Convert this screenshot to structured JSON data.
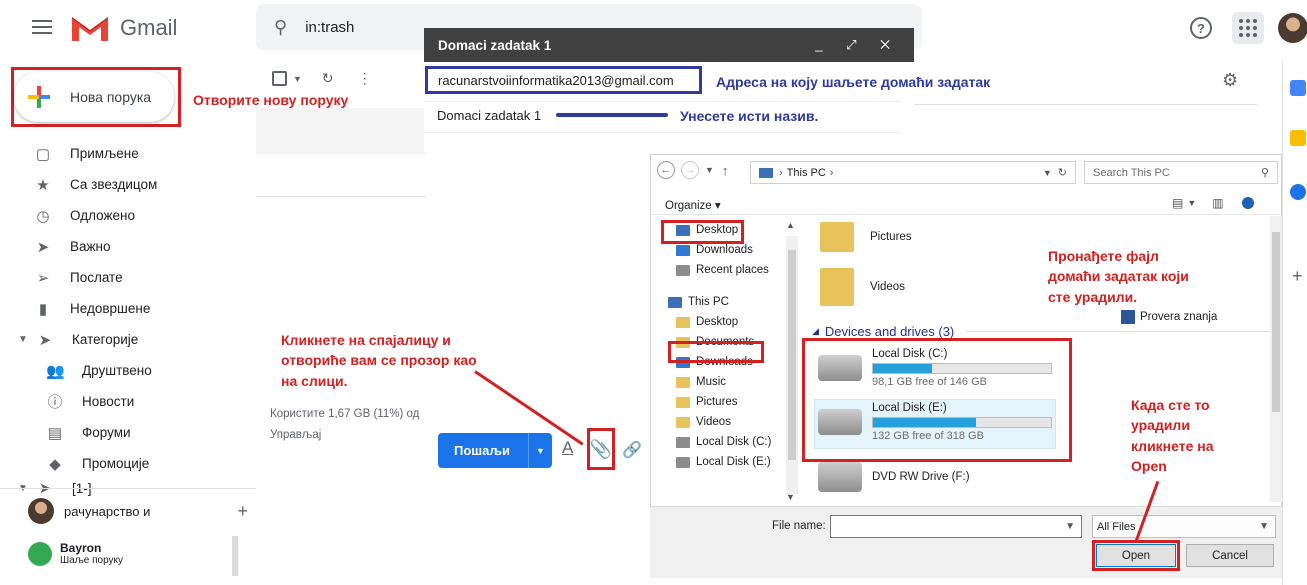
{
  "header": {
    "product": "Gmail",
    "search_query": "in:trash",
    "help_glyph": "?"
  },
  "compose_button": {
    "label": "Нова порука"
  },
  "sidebar": {
    "items": [
      {
        "label": "Примљене",
        "icon": "inbox-icon",
        "glyph": "▢"
      },
      {
        "label": "Са звездицом",
        "icon": "star-icon",
        "glyph": "★"
      },
      {
        "label": "Одложено",
        "icon": "clock-icon",
        "glyph": "◷"
      },
      {
        "label": "Важно",
        "icon": "important-icon",
        "glyph": "➤"
      },
      {
        "label": "Послате",
        "icon": "send-icon",
        "glyph": "➢"
      },
      {
        "label": "Недовршене",
        "icon": "draft-icon",
        "glyph": "▮"
      }
    ],
    "categories_label": "Категорије",
    "categories": [
      {
        "label": "Друштвено",
        "icon": "people-icon",
        "glyph": "👥"
      },
      {
        "label": "Новости",
        "icon": "info-icon",
        "glyph": "ⓘ"
      },
      {
        "label": "Форуми",
        "icon": "forum-icon",
        "glyph": "▤"
      },
      {
        "label": "Промоције",
        "icon": "tag-icon",
        "glyph": "◆"
      }
    ],
    "partial_item": "[1-]",
    "account_name": "рачунарство и",
    "account_plus": "+",
    "hangout_name": "Bayron",
    "hangout_status": "Шаље поруку"
  },
  "main": {
    "storage_text": "Користите 1,67 GB (11%) од",
    "manage_text": "Управљај"
  },
  "compose_window": {
    "title": "Domaci zadatak 1",
    "to": "racunarstvoiinformatika2013@gmail.com",
    "subject": "Domaci zadatak 1",
    "send_label": "Пошаљи"
  },
  "annotations": {
    "compose_note": "Отворите нову поруку",
    "address_note": "Адреса на коју шаљете домаћи задатак",
    "subject_note": "Унесете исти назив.",
    "clip_note_lines": [
      "Кликнете на спајалицу и",
      "отвориће вам се прозор као",
      "на слици."
    ],
    "find_note_lines": [
      "Пронађете фајл",
      "домаћи задатак који",
      "сте урадили."
    ],
    "open_note_lines": [
      "Када сте то",
      "урадили",
      "кликнете на",
      "Open"
    ]
  },
  "file_dialog": {
    "breadcrumb": "This PC",
    "search_placeholder": "Search This PC",
    "organize_label": "Organize ▾",
    "tree": [
      {
        "label": "Desktop",
        "kind": "desk",
        "indent": 0
      },
      {
        "label": "Downloads",
        "kind": "dl",
        "indent": 0
      },
      {
        "label": "Recent places",
        "kind": "drv",
        "indent": 0
      },
      {
        "label": "",
        "kind": "gap",
        "indent": 0
      },
      {
        "label": "This PC",
        "kind": "pc",
        "indent": -8
      },
      {
        "label": "Desktop",
        "kind": "folder",
        "indent": 0
      },
      {
        "label": "Documents",
        "kind": "folder",
        "indent": 0
      },
      {
        "label": "Downloads",
        "kind": "dl",
        "indent": 0
      },
      {
        "label": "Music",
        "kind": "folder",
        "indent": 0
      },
      {
        "label": "Pictures",
        "kind": "folder",
        "indent": 0
      },
      {
        "label": "Videos",
        "kind": "folder",
        "indent": 0
      },
      {
        "label": "Local Disk (C:)",
        "kind": "drv",
        "indent": 0
      },
      {
        "label": "Local Disk (E:)",
        "kind": "drv",
        "indent": 0
      }
    ],
    "folders": [
      "Pictures",
      "Videos"
    ],
    "devices_heading": "Devices and drives (3)",
    "document_file": "Provera znanja",
    "drives": [
      {
        "name": "Local Disk (C:)",
        "free": "98,1 GB free of 146 GB",
        "used_fraction": 0.33
      },
      {
        "name": "Local Disk (E:)",
        "free": "132 GB free of 318 GB",
        "used_fraction": 0.58
      },
      {
        "name": "DVD RW Drive (F:)",
        "free": "",
        "used_fraction": null
      }
    ],
    "file_name_label": "File name:",
    "file_type": "All Files",
    "open_label": "Open",
    "cancel_label": "Cancel"
  },
  "colors": {
    "annotation_red": "#d32020",
    "annotation_blue": "#2e3aa0",
    "gmail_blue": "#1a73e8"
  }
}
